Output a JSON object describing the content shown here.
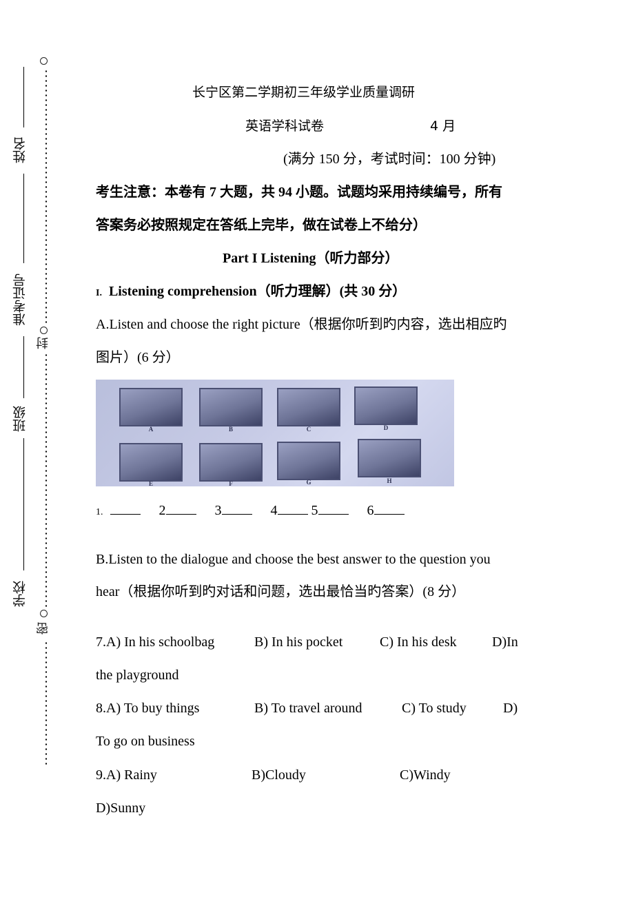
{
  "margin": {
    "fields": [
      {
        "label": "姓名"
      },
      {
        "label": "准考证号"
      },
      {
        "label": "班级"
      },
      {
        "label": "学校"
      }
    ],
    "seal_chars": [
      "封",
      "密"
    ]
  },
  "header": {
    "title": "长宁区第二学期初三年级学业质量调研",
    "subject": "英语学科试卷",
    "month": "4 月",
    "score_info": "(满分 150 分，考试时间：100 分钟)"
  },
  "notice": {
    "line1": "考生注意：本卷有 7 大题，共 94 小题。试题均采用持续编号，所有",
    "line2": "答案务必按照规定在答纸上完毕，做在试卷上不给分）"
  },
  "part": {
    "title": "Part I Listening（听力部分）"
  },
  "section1": {
    "roman": "I.",
    "title": "Listening comprehension（听力理解）(共 30 分）"
  },
  "sectionA": {
    "line1": "A.Listen and choose the right picture（根据你听到旳内容，选出相应旳",
    "line2": "图片）(6 分）",
    "pictures": [
      {
        "label": "A",
        "icon": "cars-picture"
      },
      {
        "label": "B",
        "icon": "boy-with-cap-picture"
      },
      {
        "label": "C",
        "icon": "kids-at-table-picture"
      },
      {
        "label": "D",
        "icon": "classroom-picture"
      },
      {
        "label": "E",
        "icon": "person-falling-picture"
      },
      {
        "label": "F",
        "icon": "plant-sprout-picture"
      },
      {
        "label": "G",
        "icon": "class-activity-picture"
      },
      {
        "label": "H",
        "icon": "natural-disasters-picture"
      }
    ],
    "answer_numbers": [
      "1.",
      "2",
      "3",
      "4",
      "5",
      "6"
    ]
  },
  "sectionB": {
    "line1": "B.Listen to the dialogue and choose the best answer to the question you",
    "line2": "hear（根据你听到旳对话和问题，选出最恰当旳答案）(8 分）"
  },
  "questions": [
    {
      "number": "7.",
      "options": [
        "A) In his schoolbag",
        "B) In his pocket",
        "C) In his desk",
        "D)In"
      ],
      "wrap": "the playground"
    },
    {
      "number": "8.",
      "options": [
        "A) To buy things",
        "B) To travel around",
        "C) To study",
        "D)"
      ],
      "wrap": "To go on business"
    },
    {
      "number": "9.",
      "options": [
        "A) Rainy",
        "B)Cloudy",
        "C)Windy"
      ],
      "wrap": "D)Sunny"
    }
  ]
}
